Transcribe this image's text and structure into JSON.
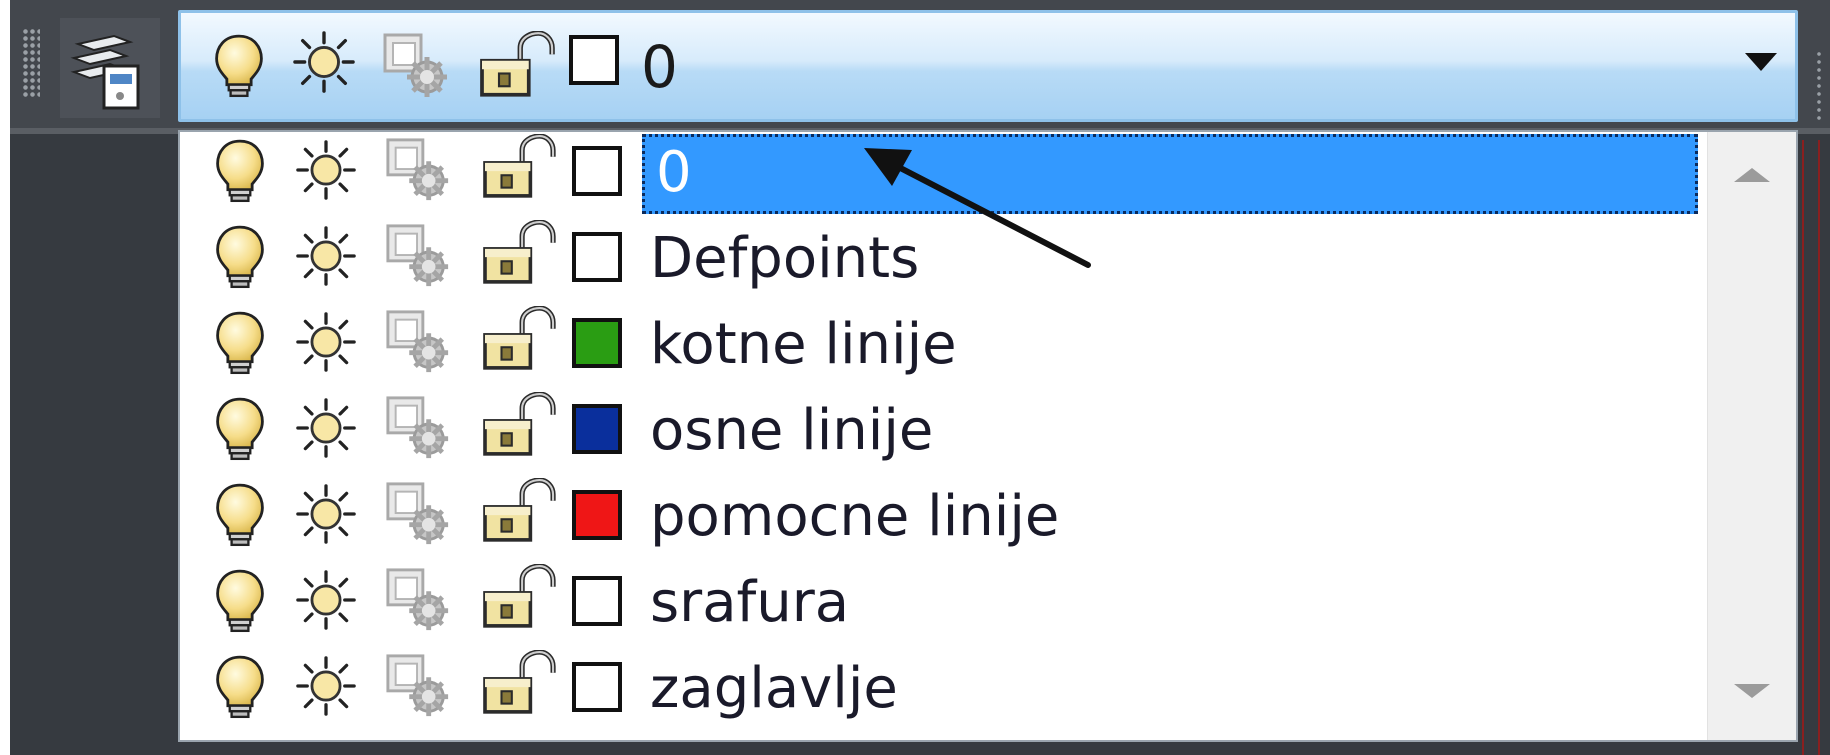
{
  "layer_control": {
    "current_layer": {
      "name": "0",
      "color": "#ffffff",
      "icons": [
        "lightbulb-on-icon",
        "sun-thaw-icon",
        "viewport-freeze-icon",
        "padlock-unlocked-icon"
      ]
    }
  },
  "layers": [
    {
      "name": "0",
      "color": "#ffffff",
      "selected": true
    },
    {
      "name": "Defpoints",
      "color": "#ffffff",
      "selected": false
    },
    {
      "name": "kotne linije",
      "color": "#2a9d13",
      "selected": false
    },
    {
      "name": "osne linije",
      "color": "#0a2f9c",
      "selected": false
    },
    {
      "name": "pomocne linije",
      "color": "#ef1616",
      "selected": false
    },
    {
      "name": "srafura",
      "color": "#ffffff",
      "selected": false
    },
    {
      "name": "zaglavlje",
      "color": "#ffffff",
      "selected": false
    }
  ],
  "colors": {
    "selection": "#3399ff",
    "combo_border": "#8ec1e9",
    "frame": "#363a40"
  }
}
